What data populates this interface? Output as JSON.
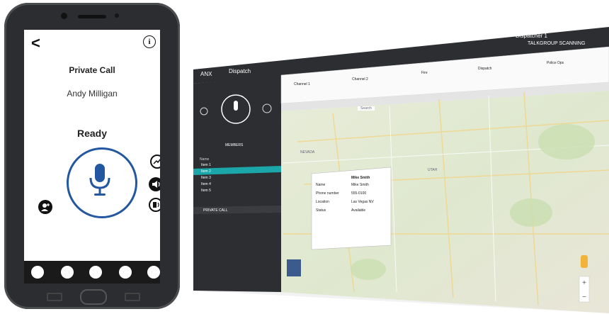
{
  "phone": {
    "title": "Private Call",
    "contact": "Andy Milligan",
    "status": "Ready",
    "back_glyph": "<",
    "info_glyph": "i"
  },
  "desktop": {
    "app_label": "Dispatch",
    "brand": "ANX",
    "user": "Dispatcher 1",
    "subheader": "TALKGROUP SCANNING",
    "channels": [
      "Channel 1",
      "Channel 2",
      "Fire",
      "Dispatch",
      "Police Ops"
    ],
    "panel_tab": "MEMBERS",
    "list_label": "Name",
    "list_items": [
      "Item 1",
      "Item 2",
      "Item 3",
      "Item 4",
      "Item 5"
    ],
    "bottom_tab": "PRIVATE CALL",
    "map_search_placeholder": "Search",
    "map_state_1": "NEVADA",
    "map_state_2": "UTAH",
    "map_popup_title": "Mike Smith",
    "map_popup_rows": [
      [
        "Name",
        "Mike Smith"
      ],
      [
        "Phone number",
        "555-0100"
      ],
      [
        "Location",
        "Las Vegas NV"
      ],
      [
        "Status",
        "Available"
      ]
    ]
  },
  "colors": {
    "accent": "#2357a0",
    "desk_dark": "#2c2e31",
    "teal": "#1ba6a9"
  }
}
